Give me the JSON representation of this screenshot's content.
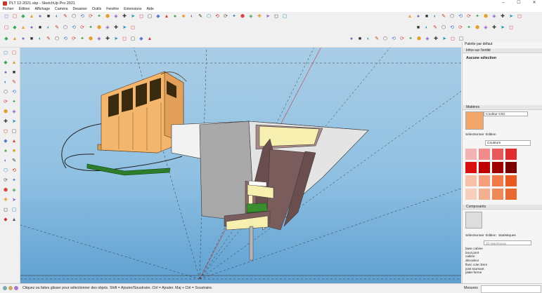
{
  "window": {
    "title": "PLT 12-2021.skp - SketchUp Pro 2021",
    "minimize": "–",
    "maximize": "☐",
    "close": "✕"
  },
  "menu": [
    "Fichier",
    "Édition",
    "Affichage",
    "Caméra",
    "Dessiner",
    "Outils",
    "Fenêtre",
    "Extensions",
    "Aide"
  ],
  "tray": {
    "default_tray": "Palette par défaut",
    "entity_info": {
      "header": "Infos sur l'entité",
      "selection": "Aucune sélection"
    },
    "materials": {
      "header": "Matières",
      "material_name": "Couleur C03",
      "tabs": [
        "Sélectionner",
        "Édition"
      ],
      "library": "Couleurs",
      "swatches": [
        "#f4b3b3",
        "#f28c8c",
        "#e85a5a",
        "#e02c2c",
        "#d81010",
        "#c00000",
        "#9e0000",
        "#7a0000",
        "#f9c0a8",
        "#f5a07a",
        "#f07a4a",
        "#e85a20",
        "#f6d0bc",
        "#f3b090",
        "#ee8a5a",
        "#e86a30"
      ]
    },
    "components": {
      "header": "Composants",
      "tabs": [
        "Sélectionner",
        "Édition",
        "Statistiques"
      ],
      "search_placeholder": "3D Warehouse",
      "items": [
        "base cabine",
        "bout pont",
        "cabine",
        "décodeur",
        "flanc cote 3mm",
        "joint tournant",
        "plate-forme"
      ]
    }
  },
  "status": {
    "hint": "Cliquez ou faites glisser pour sélectionner des objets. Shift = Ajouter/Soustraire. Ctrl = Ajouter. Maj + Ctrl = Soustraire.",
    "measure_label": "Mesures",
    "measure_value": ""
  },
  "icons": {
    "toolbar_row1": [
      "new-icon",
      "open-icon",
      "save-icon",
      "cut-icon",
      "copy-icon",
      "paste-icon",
      "erase-icon",
      "undo-icon",
      "redo-icon",
      "print-icon",
      "model-info-icon",
      "record-icon",
      "select-icon",
      "eraser-icon",
      "line-icon",
      "arc-icon",
      "shapes-icon",
      "pushpull-icon",
      "offset-icon",
      "move-icon",
      "rotate-icon",
      "scale-icon",
      "tape-icon",
      "text-icon",
      "axes-icon",
      "dimension-icon",
      "paint-icon",
      "orbit-icon",
      "pan-icon",
      "zoom-icon",
      "zoom-extents-icon",
      "add-location-icon",
      "warehouse-icon",
      "extension-warehouse-icon"
    ],
    "toolbar_row1_right": [
      "standard-views-icon",
      "iso-view-icon",
      "top-view-icon",
      "front-view-icon",
      "right-view-icon",
      "back-view-icon",
      "left-view-icon",
      "xray-icon",
      "back-edges-icon",
      "wireframe-icon",
      "hidden-line-icon",
      "shaded-icon",
      "shaded-textures-icon",
      "monochrome-icon"
    ],
    "toolbar_row2": [
      "sandbox-icon",
      "smoove-icon",
      "stamp-icon",
      "drape-icon",
      "add-detail-icon",
      "flip-edge-icon",
      "solid-union-icon",
      "solid-subtract-icon",
      "solid-trim-icon",
      "section-plane-icon",
      "section-fill-icon",
      "shadows-icon",
      "fog-icon",
      "dynamic-component-icon",
      "interact-icon",
      "photo-match-icon"
    ],
    "toolbar_row3": [
      "follow-me-icon",
      "intersect-icon",
      "outer-shell-icon",
      "camera-position-icon",
      "walk-icon",
      "look-around-icon",
      "section-display-icon",
      "layers-icon",
      "outliner-icon",
      "scenes-icon",
      "styles-icon",
      "tags-icon",
      "entity-info-icon",
      "delete-icon",
      "trash-icon",
      "shadow-settings-icon",
      "report-icon",
      "plugin-icon"
    ]
  }
}
